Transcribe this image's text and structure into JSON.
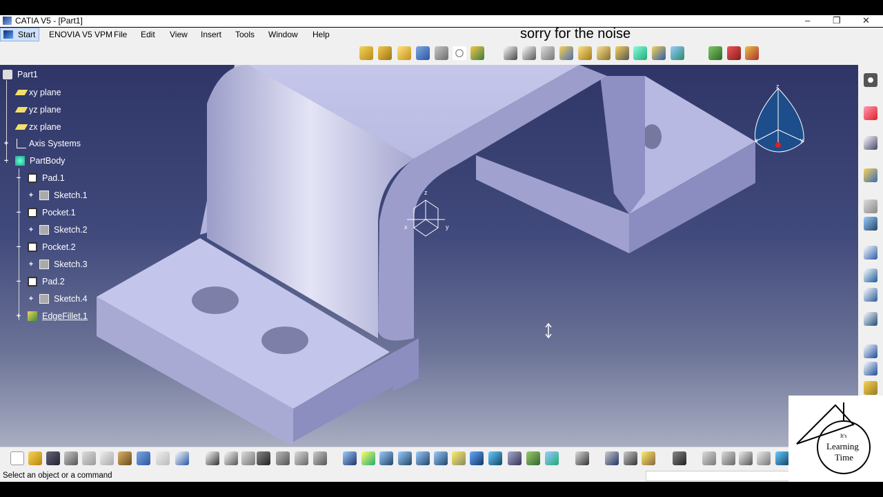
{
  "window": {
    "title": "CATIA V5 - [Part1]",
    "minimize": "–",
    "restore": "❐",
    "close": "✕"
  },
  "menubar": {
    "start": "Start",
    "items": [
      "ENOVIA V5 VPM",
      "File",
      "Edit",
      "View",
      "Insert",
      "Tools",
      "Window",
      "Help"
    ],
    "mdi": {
      "minimize": "–",
      "restore": "▫",
      "close": "✕"
    }
  },
  "overlay_note": "sorry for the noise",
  "tree": {
    "root": "Part1",
    "items": [
      {
        "label": "xy plane",
        "icon": "plane-icon"
      },
      {
        "label": "yz plane",
        "icon": "plane-icon"
      },
      {
        "label": "zx plane",
        "icon": "plane-icon"
      },
      {
        "label": "Axis Systems",
        "icon": "axis-systems-icon"
      },
      {
        "label": "PartBody",
        "icon": "partbody-icon"
      },
      {
        "label": "Pad.1",
        "icon": "pad-icon"
      },
      {
        "label": "Sketch.1",
        "icon": "sketch-icon"
      },
      {
        "label": "Pocket.1",
        "icon": "pocket-icon"
      },
      {
        "label": "Sketch.2",
        "icon": "sketch-icon"
      },
      {
        "label": "Pocket.2",
        "icon": "pocket-icon"
      },
      {
        "label": "Sketch.3",
        "icon": "sketch-icon"
      },
      {
        "label": "Pad.2",
        "icon": "pad-icon"
      },
      {
        "label": "Sketch.4",
        "icon": "sketch-icon"
      },
      {
        "label": "EdgeFillet.1",
        "icon": "edge-fillet-icon"
      }
    ]
  },
  "axis_labels": {
    "x": "x",
    "y": "y",
    "z": "z"
  },
  "compass_labels": {
    "z": "z",
    "x": "x",
    "y": "y"
  },
  "status": {
    "text": "Select an object or a command",
    "input_value": ""
  },
  "logo": {
    "line1": "It's",
    "line2": "Learning",
    "line3": "Time"
  },
  "colors": {
    "viewport_top": "#2f3567",
    "viewport_bottom": "#a9adc2",
    "part_face": "#b9badf",
    "toolbar_bg": "#f0f0f0"
  }
}
